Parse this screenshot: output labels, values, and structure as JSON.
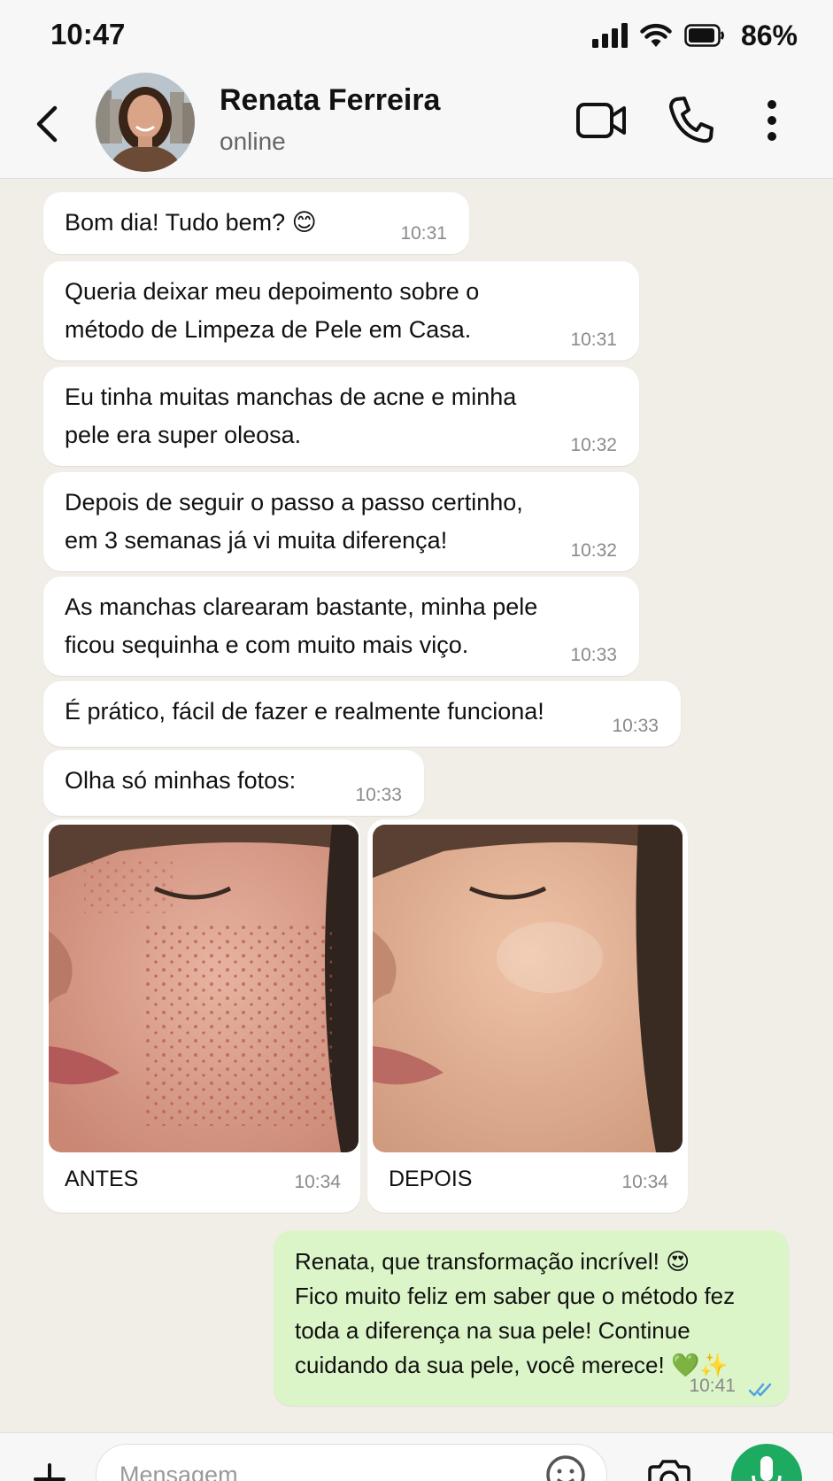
{
  "status_bar": {
    "time": "10:47",
    "battery": "86%"
  },
  "header": {
    "contact_name": "Renata Ferreira",
    "contact_status": "online"
  },
  "messages": [
    {
      "text": "Bom dia! Tudo bem? 😊",
      "time": "10:31"
    },
    {
      "text": "Queria deixar meu depoimento sobre o\nmétodo de Limpeza de Pele em Casa.",
      "time": "10:31"
    },
    {
      "text": "Eu tinha muitas manchas de acne e minha\npele era super oleosa.",
      "time": "10:32"
    },
    {
      "text": "Depois de seguir o passo a passo certinho,\nem 3 semanas já vi muita diferença!",
      "time": "10:32"
    },
    {
      "text": "As manchas clarearam bastante, minha pele\nficou sequinha e com muito mais viço.",
      "time": "10:33"
    },
    {
      "text": "É prático, fácil de fazer e realmente funciona!",
      "time": "10:33"
    },
    {
      "text": "Olha só minhas fotos:",
      "time": "10:33"
    }
  ],
  "photos": [
    {
      "caption": "ANTES",
      "time": "10:34"
    },
    {
      "caption": "DEPOIS",
      "time": "10:34"
    }
  ],
  "reply": {
    "text": "Renata, que transformação incrível! 😍\nFico muito feliz em saber que o método fez\ntoda a diferença na sua pele! Continue\ncuidando da sua pele, você merece! 💚✨",
    "time": "10:41"
  },
  "input": {
    "placeholder": "Mensagem"
  },
  "colors": {
    "chat_background": "#f1eee8",
    "outgoing_bubble": "#dcf5c8",
    "mic_button": "#1daa61",
    "read_ticks": "#4fa3e0"
  },
  "icons": [
    "signal-icon",
    "wifi-icon",
    "battery-icon",
    "back-arrow-icon",
    "video-camera-icon",
    "phone-icon",
    "more-vertical-icon",
    "plus-icon",
    "emoji-icon",
    "camera-icon",
    "microphone-icon",
    "double-check-icon"
  ]
}
